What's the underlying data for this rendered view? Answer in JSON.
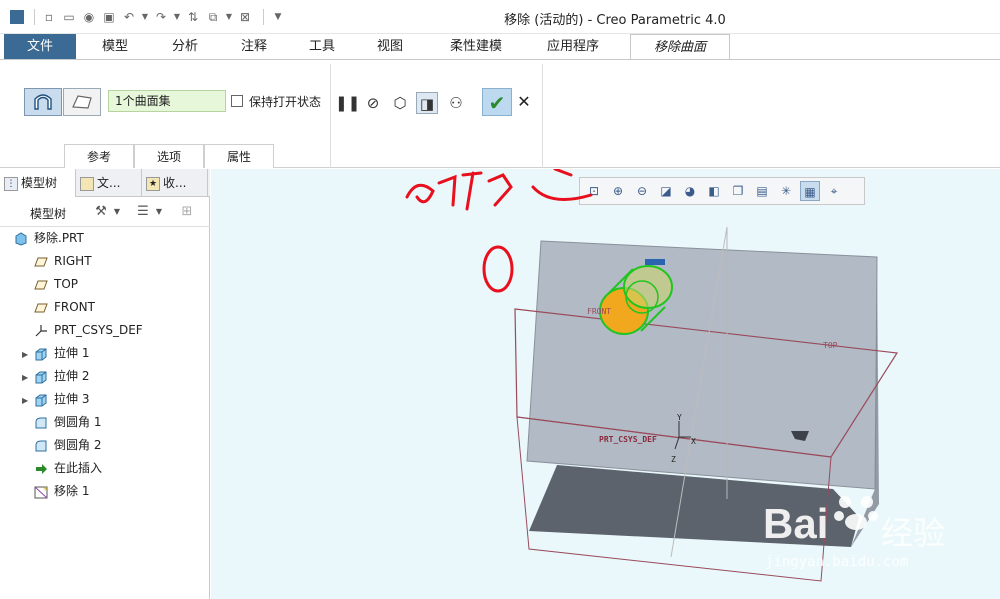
{
  "window": {
    "title": "移除 (活动的) - Creo Parametric 4.0"
  },
  "ribbon_tabs": [
    {
      "label": "文件"
    },
    {
      "label": "模型"
    },
    {
      "label": "分析"
    },
    {
      "label": "注释"
    },
    {
      "label": "工具"
    },
    {
      "label": "视图"
    },
    {
      "label": "柔性建模"
    },
    {
      "label": "应用程序"
    },
    {
      "label": "移除曲面"
    }
  ],
  "dashboard": {
    "collector_value": "1个曲面集",
    "keep_open_label": "保持打开状态",
    "keep_open_checked": false,
    "tabs": [
      {
        "label": "参考"
      },
      {
        "label": "选项"
      },
      {
        "label": "属性"
      }
    ]
  },
  "panel": {
    "tabs": [
      {
        "label": "模型树"
      },
      {
        "label": "文..."
      },
      {
        "label": "收..."
      }
    ],
    "toolbar_label": "模型树"
  },
  "tree": [
    {
      "label": "移除.PRT",
      "icon": "part-icon"
    },
    {
      "label": "RIGHT",
      "icon": "datum-plane-icon"
    },
    {
      "label": "TOP",
      "icon": "datum-plane-icon"
    },
    {
      "label": "FRONT",
      "icon": "datum-plane-icon"
    },
    {
      "label": "PRT_CSYS_DEF",
      "icon": "csys-icon"
    },
    {
      "label": "拉伸 1",
      "icon": "extrude-icon",
      "expandable": true
    },
    {
      "label": "拉伸 2",
      "icon": "extrude-icon",
      "expandable": true
    },
    {
      "label": "拉伸 3",
      "icon": "extrude-icon",
      "expandable": true
    },
    {
      "label": "倒圆角 1",
      "icon": "round-icon"
    },
    {
      "label": "倒圆角 2",
      "icon": "round-icon"
    },
    {
      "label": "在此插入",
      "icon": "insert-here-icon"
    },
    {
      "label": "移除 1",
      "icon": "remove-feature-icon"
    }
  ],
  "model": {
    "labels": {
      "front": "FRONT",
      "top": "TOP",
      "csys": "PRT_CSYS_DEF",
      "x": "X",
      "y": "Y",
      "z": "Z"
    }
  },
  "annotation": {
    "note": "确定"
  },
  "watermark": {
    "brand": "Bai",
    "brand2": "经验",
    "url": "jingyan.baidu.com"
  },
  "colors": {
    "file_tab": "#3b6a95",
    "viewport_bg": "#eaf8fb",
    "collector_bg": "#e7f7d9",
    "annotation": "#e8101e",
    "highlight": "#22c422",
    "selected_face": "#f2a81e"
  }
}
